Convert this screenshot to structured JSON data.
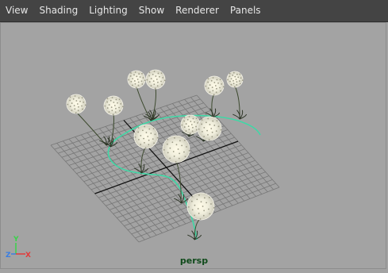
{
  "menubar": {
    "items": [
      "View",
      "Shading",
      "Lighting",
      "Show",
      "Renderer",
      "Panels"
    ]
  },
  "viewport": {
    "camera": "persp",
    "background": "#a3a3a3",
    "grid_color": "#777777",
    "axis_line_color": "#111111",
    "curve_color": "#3fd8a6",
    "axis_gizmo": {
      "x": "X",
      "y": "Y",
      "z": "Z",
      "x_color": "#e23a3a",
      "y_color": "#3ad24a",
      "z_color": "#3a7ee2"
    }
  }
}
